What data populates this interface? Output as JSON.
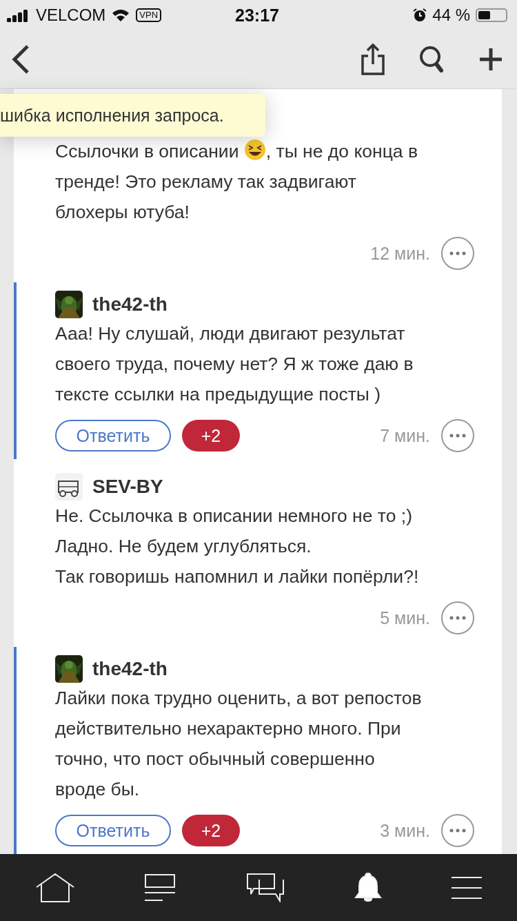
{
  "status_bar": {
    "carrier": "VELCOM",
    "vpn": "VPN",
    "time": "23:17",
    "battery": "44 %"
  },
  "tooltip": {
    "text": "шибка исполнения запроса."
  },
  "comments": [
    {
      "highlighted": false,
      "body": [
        {
          "kind": "text",
          "text": "Ссылочки в описании "
        },
        {
          "kind": "icon"
        },
        {
          "kind": "text",
          "text": ", ты не до конца в\nтренде! Это рекламу так задвигают\nблохеры ютуба!"
        }
      ],
      "time": "12 мин."
    },
    {
      "highlighted": true,
      "author": "the42-th",
      "body": [
        {
          "kind": "text",
          "text": "Ааа! Ну слушай, люди двигают результат\nсвоего труда, почему нет? Я ж тоже даю в\nтексте ссылки на предыдущие посты )"
        }
      ],
      "reply": "Ответить",
      "score": "+2",
      "time": "7 мин."
    },
    {
      "highlighted": false,
      "author": "SEV-BY",
      "body": [
        {
          "kind": "text",
          "text": "Не. Ссылочка в описании немного не то ;)\nЛадно. Не будем углубляться.\nТак говоришь напомнил и лайки попёрли?!"
        }
      ],
      "time": "5 мин."
    },
    {
      "highlighted": true,
      "author": "the42-th",
      "body": [
        {
          "kind": "text",
          "text": "Лайки пока трудно оценить, а вот репостов\nдействительно нехарактерно много. При\nточно, что пост обычный совершенно\nвроде бы."
        }
      ],
      "reply": "Ответить",
      "score": "+2",
      "time": "3 мин."
    }
  ],
  "tabs": [
    {
      "kind": "home",
      "selected": false
    },
    {
      "kind": "feed",
      "selected": false
    },
    {
      "kind": "chat",
      "selected": false
    },
    {
      "kind": "bell",
      "selected": true
    },
    {
      "kind": "menu",
      "selected": false
    }
  ]
}
